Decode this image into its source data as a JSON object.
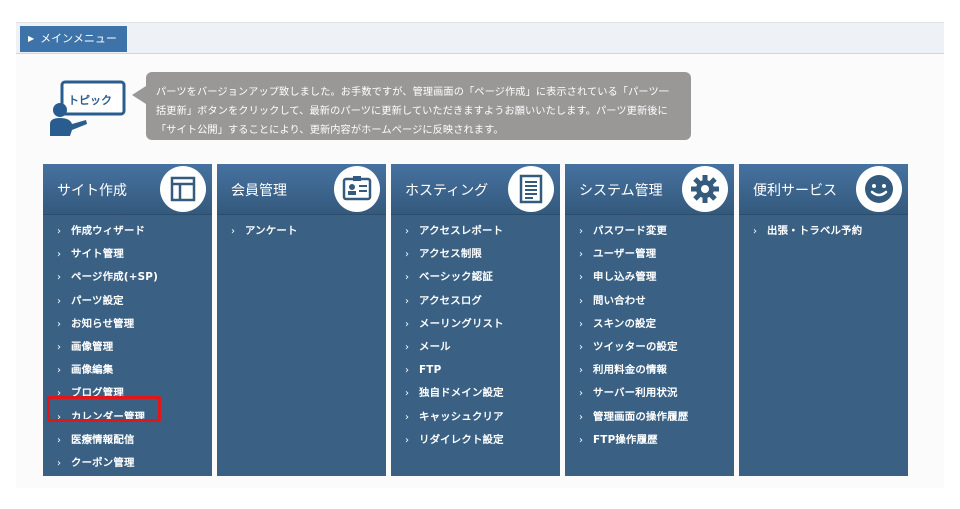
{
  "menu": {
    "tab_label": "メインメニュー"
  },
  "topic": {
    "badge": "トピック",
    "lines": [
      "パーツをバージョンアップ致しました。お手数ですが、管理画面の「ページ作成」に表示されている「パーツ一",
      "括更新」ボタンをクリックして、最新のパーツに更新していただきますようお願いいたします。パーツ更新後に",
      "「サイト公開」することにより、更新内容がホームページに反映されます。"
    ]
  },
  "columns": [
    {
      "title": "サイト作成",
      "icon": "layout-icon",
      "items": [
        "作成ウィザード",
        "サイト管理",
        "ページ作成(+SP)",
        "パーツ設定",
        "お知らせ管理",
        "画像管理",
        "画像編集",
        "ブログ管理",
        "カレンダー管理",
        "医療情報配信",
        "クーポン管理"
      ]
    },
    {
      "title": "会員管理",
      "icon": "id-card-icon",
      "items": [
        "アンケート"
      ]
    },
    {
      "title": "ホスティング",
      "icon": "document-icon",
      "items": [
        "アクセスレポート",
        "アクセス制限",
        "ベーシック認証",
        "アクセスログ",
        "メーリングリスト",
        "メール",
        "FTP",
        "独自ドメイン設定",
        "キャッシュクリア",
        "リダイレクト設定"
      ]
    },
    {
      "title": "システム管理",
      "icon": "gear-icon",
      "items": [
        "パスワード変更",
        "ユーザー管理",
        "申し込み管理",
        "問い合わせ",
        "スキンの設定",
        "ツイッターの設定",
        "利用料金の情報",
        "サーバー利用状況",
        "管理画面の操作履歴",
        "FTP操作履歴"
      ]
    },
    {
      "title": "便利サービス",
      "icon": "smile-icon",
      "items": [
        "出張・トラベル予約"
      ]
    }
  ],
  "colors": {
    "accent": "#3d73a9",
    "column_bg": "#3a6184",
    "highlight": "#e0161a",
    "bubble": "#9a9797"
  }
}
